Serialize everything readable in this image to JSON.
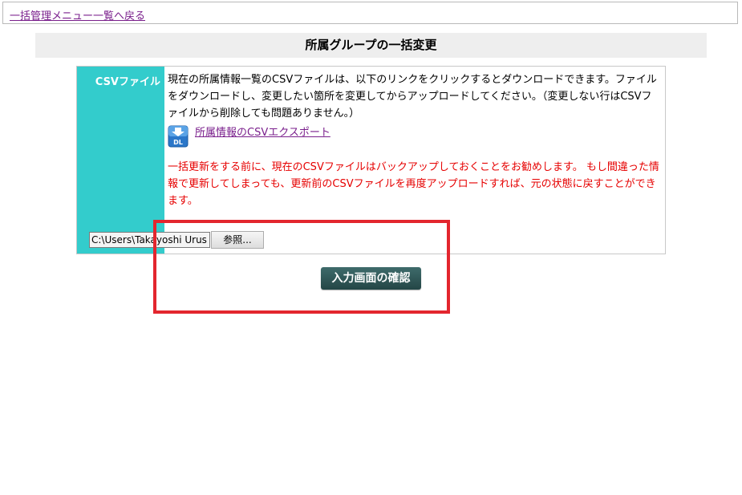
{
  "nav": {
    "back_link": "一括管理メニュー一覧へ戻る"
  },
  "page": {
    "title": "所属グループの一括変更"
  },
  "form": {
    "label": "CSVファイル",
    "description": "現在の所属情報一覧のCSVファイルは、以下のリンクをクリックするとダウンロードできます。ファイルをダウンロードし、変更したい箇所を変更してからアップロードしてください。（変更しない行はCSVファイルから削除しても問題ありません。）",
    "export_link": "所属情報のCSVエクスポート",
    "export_icon_text": "DL",
    "warning": "一括更新をする前に、現在のCSVファイルはバックアップしておくことをお勧めします。 もし間違った情報で更新してしまっても、更新前のCSVファイルを再度アップロードすれば、元の状態に戻すことができます。",
    "file_path": "C:\\Users\\Takayoshi Urus",
    "browse_label": "参照..."
  },
  "actions": {
    "confirm_label": "入力画面の確認"
  },
  "colors": {
    "label_bg": "#33cccc",
    "warning": "#e60000",
    "highlight": "#e3262e",
    "confirm_bg": "#2f5656"
  }
}
